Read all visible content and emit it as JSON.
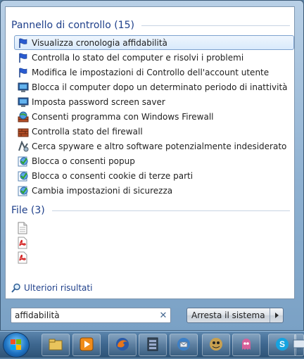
{
  "control_panel": {
    "header": "Pannello di controllo (15)",
    "items": [
      {
        "label": "Visualizza cronologia affidabilità",
        "icon": "flag-icon",
        "selected": true
      },
      {
        "label": "Controlla lo stato del computer e risolvi i problemi",
        "icon": "flag-icon"
      },
      {
        "label": "Modifica le impostazioni di Controllo dell'account utente",
        "icon": "flag-icon"
      },
      {
        "label": "Blocca il computer dopo un determinato periodo di inattività",
        "icon": "monitor-icon"
      },
      {
        "label": "Imposta password screen saver",
        "icon": "monitor-icon"
      },
      {
        "label": "Consenti programma con Windows Firewall",
        "icon": "firewall-globe-icon"
      },
      {
        "label": "Controlla stato del firewall",
        "icon": "firewall-icon"
      },
      {
        "label": "Cerca spyware e altro software potenzialmente indesiderato",
        "icon": "defender-icon"
      },
      {
        "label": "Blocca o consenti popup",
        "icon": "internet-options-icon"
      },
      {
        "label": "Blocca o consenti cookie di terze parti",
        "icon": "internet-options-icon"
      },
      {
        "label": "Cambia impostazioni di sicurezza",
        "icon": "internet-options-icon"
      }
    ]
  },
  "files": {
    "header": "File (3)",
    "items": [
      {
        "icon": "text-document-icon"
      },
      {
        "icon": "pdf-icon"
      },
      {
        "icon": "pdf-icon"
      }
    ]
  },
  "more_results": "Ulteriori risultati",
  "search": {
    "value": "affidabilità",
    "clear_icon": "close-icon"
  },
  "shutdown": {
    "label": "Arresta il sistema",
    "arrow_icon": "chevron-right-icon"
  },
  "taskbar": {
    "start_icon": "windows-start-orb-icon",
    "apps": [
      "explorer-icon",
      "media-player-icon",
      "firefox-icon",
      "app-icon",
      "thunderbird-icon",
      "game-icon",
      "pacman-icon",
      "skype-icon",
      "network-icon"
    ]
  },
  "colors": {
    "accent": "#1e3f8a",
    "selection": "#d9eafc"
  }
}
